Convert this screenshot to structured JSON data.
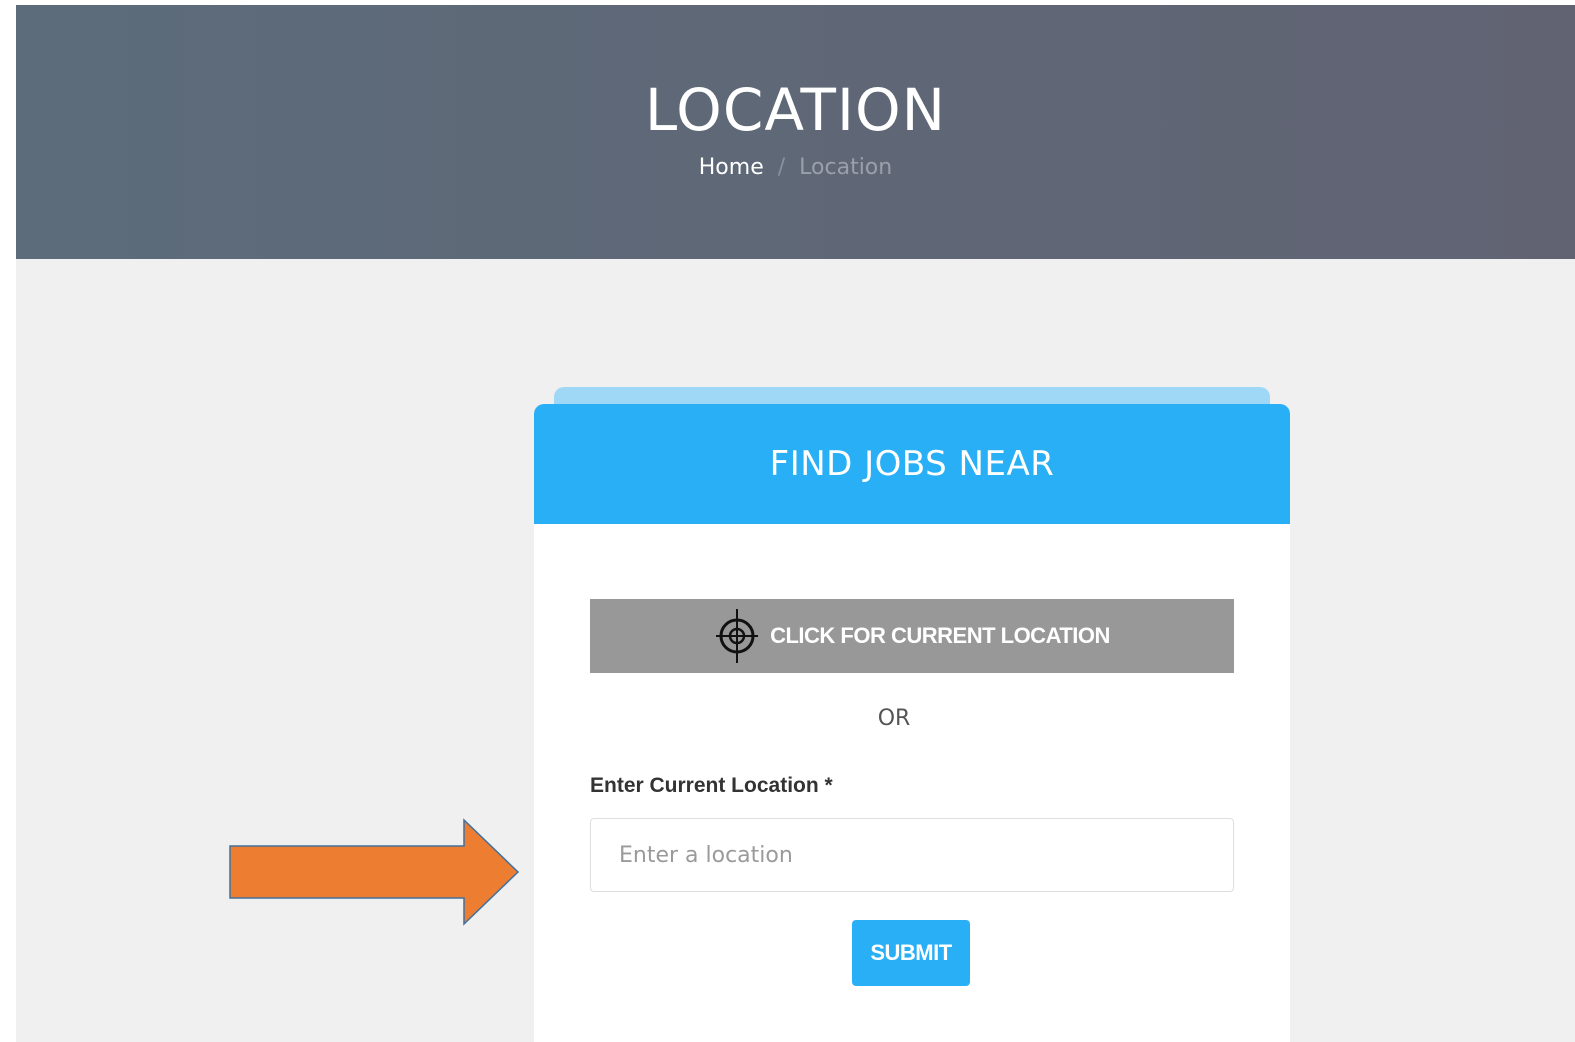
{
  "hero": {
    "title": "LOCATION",
    "breadcrumb": {
      "home": "Home",
      "separator": "/",
      "current": "Location"
    }
  },
  "card": {
    "title": "FIND JOBS NEAR",
    "geo_button_label": "CLICK FOR CURRENT LOCATION",
    "geo_icon": "crosshair-target-icon",
    "or_text": "OR",
    "field_label": "Enter Current Location *",
    "location_input": {
      "value": "",
      "placeholder": "Enter a location"
    },
    "submit_label": "SUBMIT"
  },
  "annotation": {
    "arrow_color": "#ed7d31",
    "arrow_points_to": "location-input"
  },
  "colors": {
    "accent": "#29aff5",
    "geo_button": "#989898",
    "hero_bg": "#5e6878",
    "content_bg": "#f0f0f0"
  }
}
